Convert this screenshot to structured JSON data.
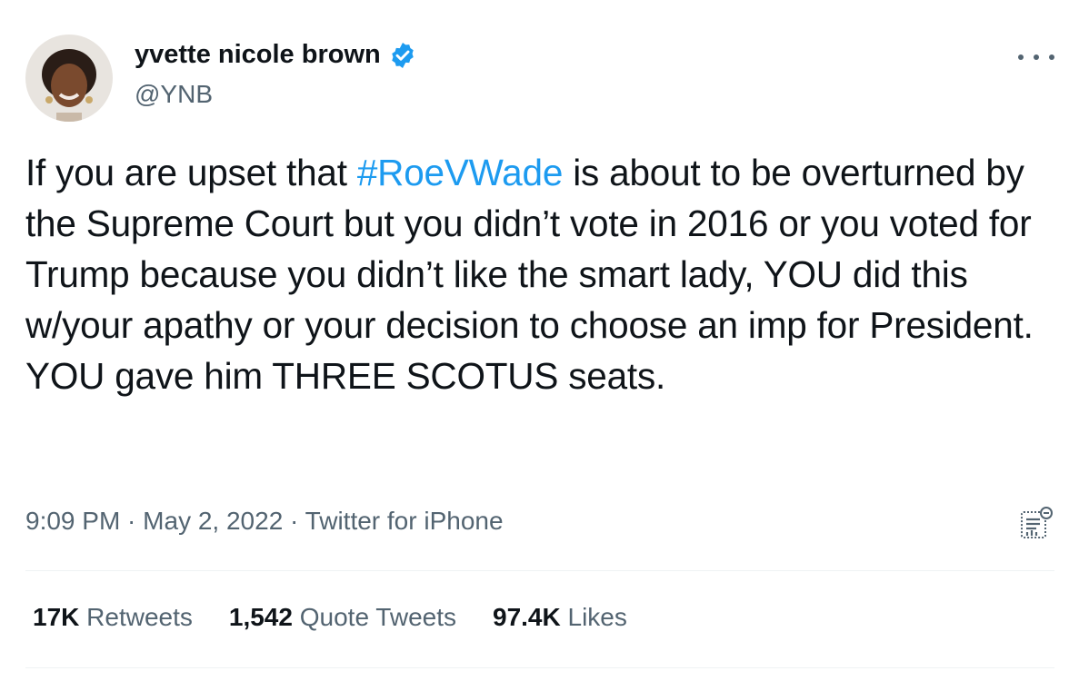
{
  "author": {
    "name": "yvette nicole brown",
    "handle": "@YNB",
    "verified_color": "#1d9bf0"
  },
  "tweet": {
    "text_before": "If you are upset that ",
    "hashtag": "#RoeVWade",
    "text_after": " is about to be overturned by the Supreme Court but you didn’t vote in 2016 or you voted for Trump because you didn’t like the smart lady, YOU did this w/your apathy or your decision to choose an imp for President. YOU gave him THREE SCOTUS seats."
  },
  "meta": {
    "time": "9:09 PM",
    "separator": " · ",
    "date": "May 2, 2022",
    "source": "Twitter for iPhone"
  },
  "stats": {
    "retweets_count": "17K",
    "retweets_label": "Retweets",
    "quotes_count": "1,542",
    "quotes_label": "Quote Tweets",
    "likes_count": "97.4K",
    "likes_label": "Likes"
  },
  "icons": {
    "more": "more-options-icon",
    "analytics": "analytics-icon",
    "verified": "verified-badge-icon"
  }
}
